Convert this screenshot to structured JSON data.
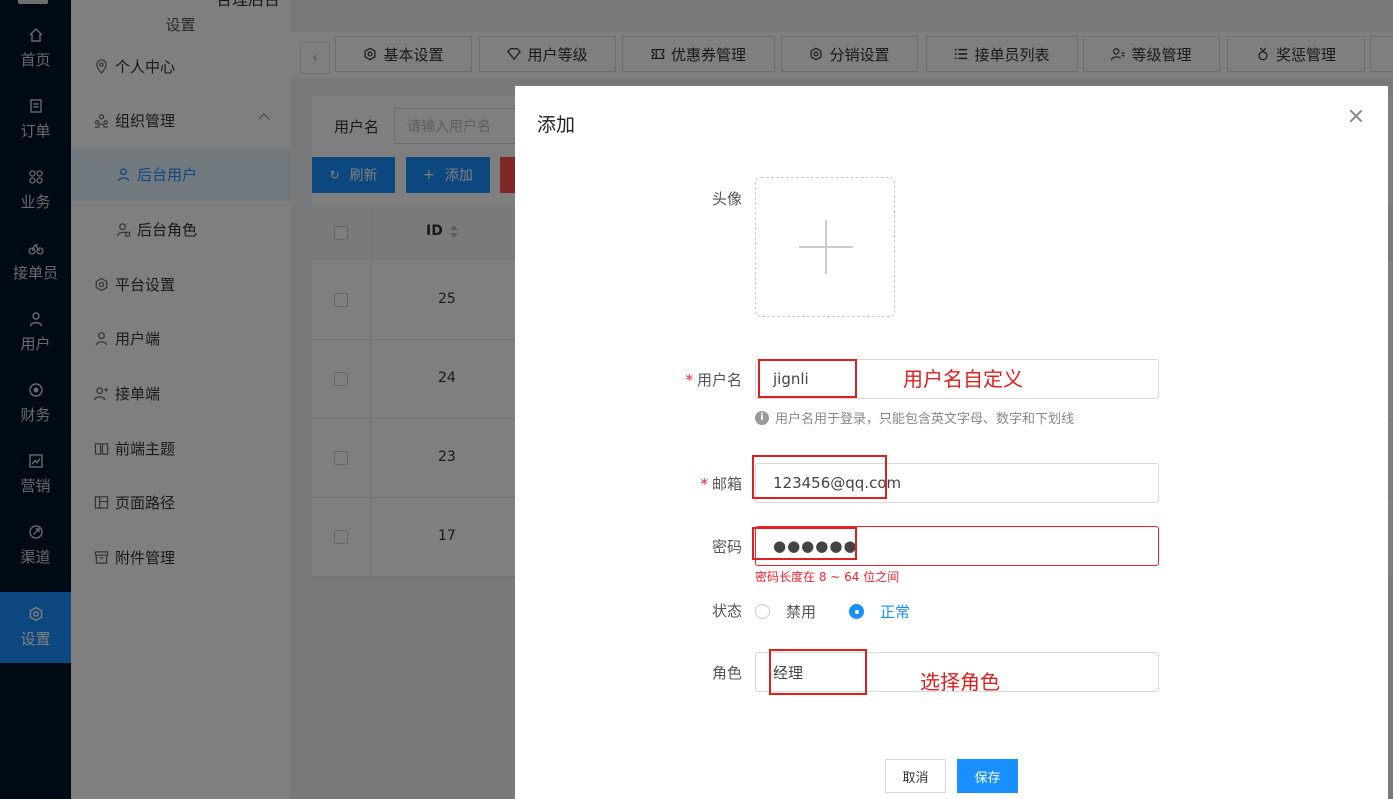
{
  "rail": {
    "items": [
      {
        "label": "首页",
        "icon": "home-icon"
      },
      {
        "label": "订单",
        "icon": "order-icon"
      },
      {
        "label": "业务",
        "icon": "grid-icon"
      },
      {
        "label": "接单员",
        "icon": "bike-icon"
      },
      {
        "label": "用户",
        "icon": "user-icon"
      },
      {
        "label": "财务",
        "icon": "finance-icon"
      },
      {
        "label": "营销",
        "icon": "chart-icon"
      },
      {
        "label": "渠道",
        "icon": "channel-icon"
      },
      {
        "label": "设置",
        "icon": "settings-icon",
        "active": true
      }
    ]
  },
  "sidebar": {
    "title_top": "合理后台",
    "title": "设置",
    "items": [
      {
        "label": "个人中心",
        "icon": "location-icon"
      },
      {
        "label": "组织管理",
        "icon": "org-icon",
        "expanded": true
      },
      {
        "label": "后台用户",
        "icon": "user-icon",
        "child": true,
        "active": true
      },
      {
        "label": "后台角色",
        "icon": "user-role-icon",
        "child": true
      },
      {
        "label": "平台设置",
        "icon": "hexagon-icon"
      },
      {
        "label": "用户端",
        "icon": "user-icon"
      },
      {
        "label": "接单端",
        "icon": "user-plus-icon"
      },
      {
        "label": "前端主题",
        "icon": "book-icon"
      },
      {
        "label": "页面路径",
        "icon": "layout-icon"
      },
      {
        "label": "附件管理",
        "icon": "archive-icon"
      }
    ]
  },
  "tabs": [
    {
      "label": "基本设置",
      "icon": "hexagon-icon"
    },
    {
      "label": "用户等级",
      "icon": "diamond-icon"
    },
    {
      "label": "优惠券管理",
      "icon": "ticket-icon"
    },
    {
      "label": "分销设置",
      "icon": "hexagon-icon"
    },
    {
      "label": "接单员列表",
      "icon": "list-icon"
    },
    {
      "label": "等级管理",
      "icon": "user-level-icon"
    },
    {
      "label": "奖惩管理",
      "icon": "medal-icon"
    }
  ],
  "filter": {
    "label": "用户名",
    "placeholder": "请输入用户名"
  },
  "toolbar": {
    "refresh": "刷新",
    "add": "添加"
  },
  "table": {
    "id_header": "ID",
    "rows": [
      {
        "id": "25"
      },
      {
        "id": "24"
      },
      {
        "id": "23"
      },
      {
        "id": "17"
      }
    ]
  },
  "modal": {
    "title": "添加",
    "avatar_label": "头像",
    "username_label": "用户名",
    "username_value": "jignli",
    "username_hint": "用户名用于登录，只能包含英文字母、数字和下划线",
    "email_label": "邮箱",
    "email_value": "123456@qq.com",
    "password_label": "密码",
    "password_value": "●●●●●●",
    "password_error": "密码长度在 8 ~ 64 位之间",
    "status_label": "状态",
    "status_options": [
      "禁用",
      "正常"
    ],
    "status_selected": "正常",
    "role_label": "角色",
    "role_value": "经理",
    "cancel": "取消",
    "save": "保存"
  },
  "annotations": {
    "username_note": "用户名自定义",
    "role_note": "选择角色",
    "color": "#e02020"
  },
  "colors": {
    "primary": "#1890ff",
    "rail": "#001529",
    "error": "#f5222d"
  }
}
